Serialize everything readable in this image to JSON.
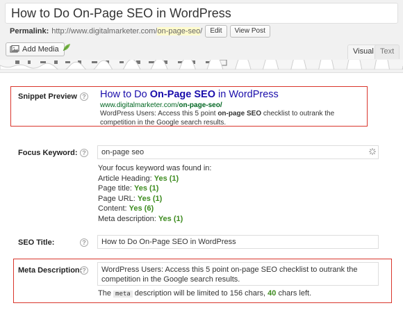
{
  "editor": {
    "post_title": "How to Do On-Page SEO in WordPress",
    "permalink_label": "Permalink:",
    "permalink_base": "http://www.digitalmarketer.com/",
    "permalink_slug": "on-page-seo",
    "permalink_trailing": "/",
    "edit_button": "Edit",
    "view_post_button": "View Post",
    "add_media_button": "Add Media",
    "tabs": {
      "visual": "Visual",
      "text": "Text"
    }
  },
  "seo": {
    "snippet_preview": {
      "label": "Snippet Preview",
      "title_prefix": "How to Do ",
      "title_keyword": "On-Page SEO",
      "title_suffix": " in WordPress",
      "url_base": "www.digitalmarketer.com/",
      "url_slug": "on-page-seo/",
      "desc_prefix": "WordPress Users: Access this 5 point ",
      "desc_keyword": "on-page SEO",
      "desc_suffix": " checklist to outrank the competition in the Google search results."
    },
    "focus_keyword": {
      "label": "Focus Keyword:",
      "value": "on-page seo",
      "found_intro": "Your focus keyword was found in:",
      "results": [
        {
          "label": "Article Heading:",
          "value": "Yes (1)"
        },
        {
          "label": "Page title:",
          "value": "Yes (1)"
        },
        {
          "label": "Page URL:",
          "value": "Yes (1)"
        },
        {
          "label": "Content:",
          "value": "Yes (6)"
        },
        {
          "label": "Meta description:",
          "value": "Yes (1)"
        }
      ]
    },
    "seo_title": {
      "label": "SEO Title:",
      "value": "How to Do On-Page SEO in WordPress"
    },
    "meta_description": {
      "label": "Meta Description:",
      "value": "WordPress Users:  Access this 5 point on-page SEO checklist to outrank the competition in the Google search results.",
      "note_prefix": "The",
      "note_code": "meta",
      "note_middle": "description will be limited to 156 chars,",
      "chars_left": "40",
      "note_suffix": "chars left."
    },
    "help_glyph": "?"
  },
  "colors": {
    "accent_red": "#d9352b",
    "yes_green": "#3d8b1f",
    "snippet_link": "#1a0dab",
    "snippet_url": "#006621"
  }
}
